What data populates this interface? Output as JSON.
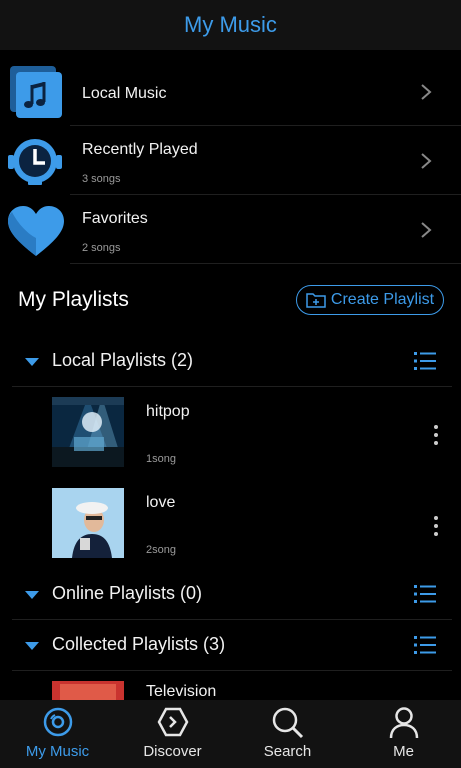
{
  "header": {
    "title": "My Music"
  },
  "library": [
    {
      "title": "Local Music",
      "subtitle": ""
    },
    {
      "title": "Recently Played",
      "subtitle": "3 songs"
    },
    {
      "title": "Favorites",
      "subtitle": "2 songs"
    }
  ],
  "playlists_section": {
    "title": "My Playlists",
    "create_label": "Create Playlist"
  },
  "groups": {
    "local": {
      "label": "Local Playlists (2)"
    },
    "online": {
      "label": "Online Playlists (0)"
    },
    "collected": {
      "label": "Collected Playlists (3)"
    }
  },
  "local_playlists": [
    {
      "name": "hitpop",
      "count": "1song"
    },
    {
      "name": "love",
      "count": "2song"
    }
  ],
  "collected_playlists": [
    {
      "name": "Television"
    }
  ],
  "nav": [
    {
      "label": "My Music",
      "icon": "disc-icon"
    },
    {
      "label": "Discover",
      "icon": "discover-icon"
    },
    {
      "label": "Search",
      "icon": "search-icon"
    },
    {
      "label": "Me",
      "icon": "person-icon"
    }
  ],
  "colors": {
    "accent": "#3d9be9",
    "background": "#000000",
    "bar": "#121212"
  }
}
